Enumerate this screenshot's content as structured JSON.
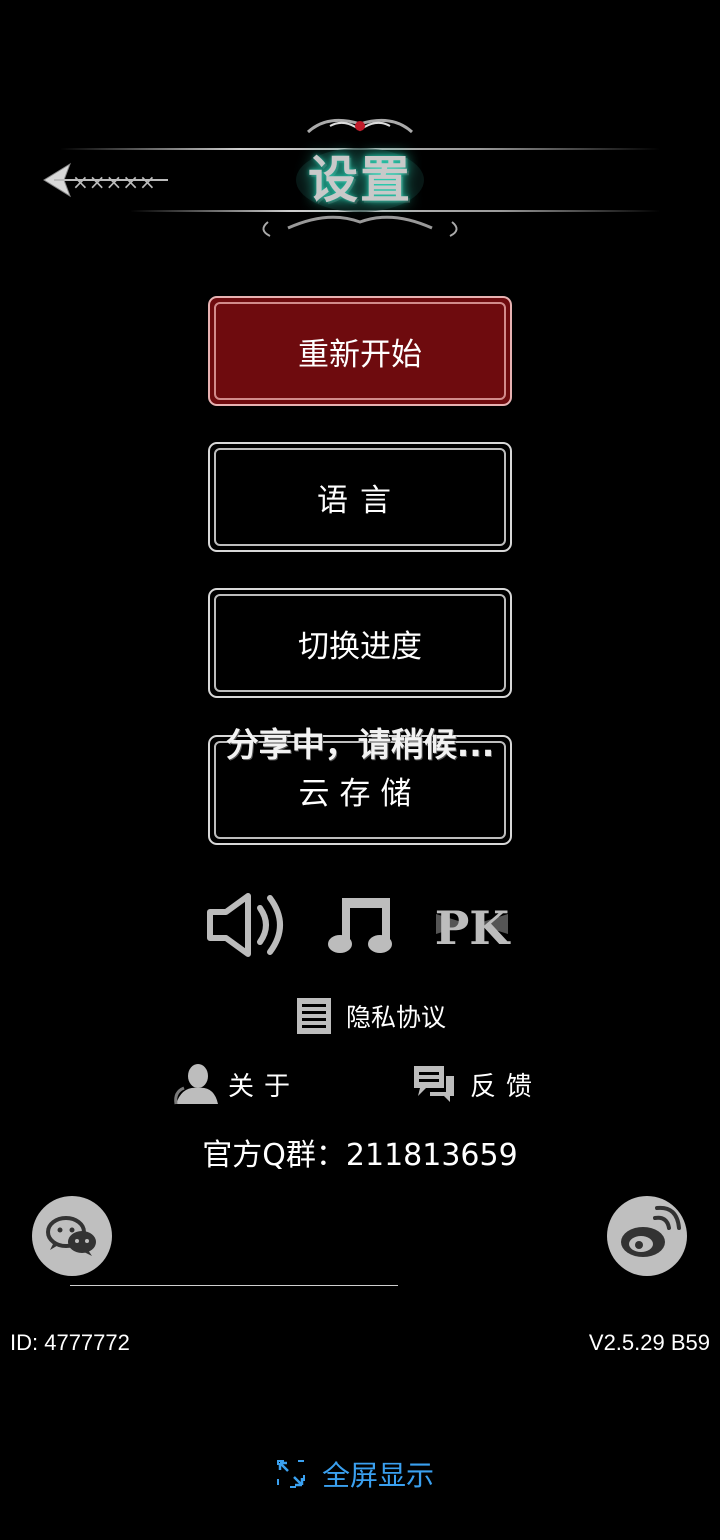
{
  "header": {
    "title": "设置",
    "back_icon": "back-arrow-icon"
  },
  "menu": {
    "restart": "重新开始",
    "language": "语言",
    "switch_progress": "切换进度",
    "cloud_storage": "云存储"
  },
  "overlay": {
    "sharing_text": "分享中，请稍候..."
  },
  "audio": {
    "sound_icon": "speaker-icon",
    "music_icon": "music-note-icon",
    "pk_icon": "pk-icon"
  },
  "links": {
    "privacy": "隐私协议",
    "about": "关于",
    "feedback": "反馈"
  },
  "qq_group": "官方Q群：211813659",
  "social": {
    "wechat_icon": "wechat-icon",
    "weibo_icon": "weibo-icon"
  },
  "footer": {
    "user_id": "ID: 4777772",
    "version": "V2.5.29 B59",
    "fullscreen": "全屏显示"
  },
  "colors": {
    "background": "#000000",
    "active_button": "#6e0b0e",
    "link_blue": "#3aa0f0",
    "icon_gray": "#bfbfbf"
  }
}
